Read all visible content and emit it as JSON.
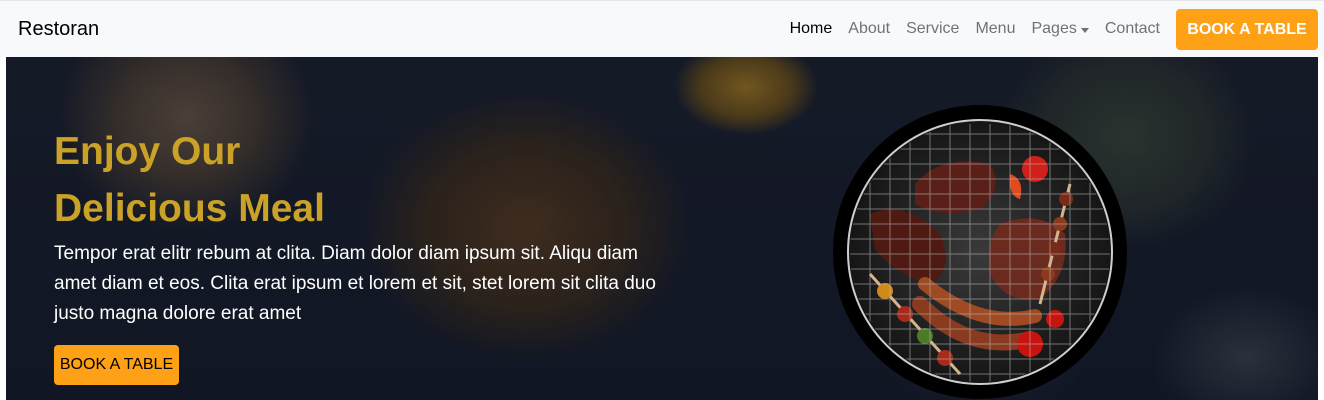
{
  "navbar": {
    "brand": "Restoran",
    "links": [
      {
        "label": "Home",
        "active": true
      },
      {
        "label": "About"
      },
      {
        "label": "Service"
      },
      {
        "label": "Menu"
      },
      {
        "label": "Pages",
        "dropdown": true
      },
      {
        "label": "Contact"
      }
    ],
    "cta_label": "BOOK A TABLE"
  },
  "hero": {
    "title_line1": "Enjoy Our",
    "title_line2": "Delicious Meal",
    "text": "Tempor erat elitr rebum at clita. Diam dolor diam ipsum sit. Aliqu diam amet diam et eos. Clita erat ipsum et lorem et sit, stet lorem sit clita duo justo magna dolore erat amet",
    "cta_label": "BOOK A TABLE",
    "image": "bbq-grill-image"
  },
  "colors": {
    "accent": "#fea116",
    "title": "#c9a227",
    "navbar_bg": "#f8f9fa",
    "hero_bg": "#121621"
  }
}
